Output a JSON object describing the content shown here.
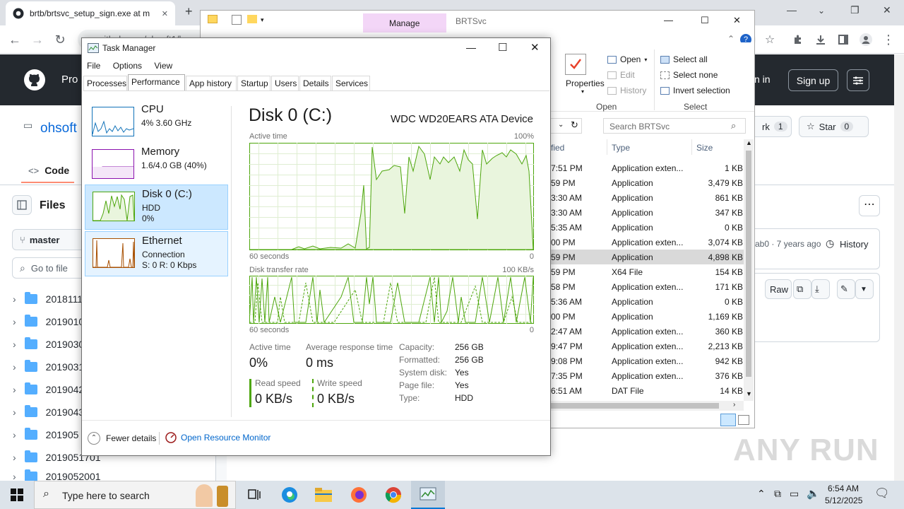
{
  "browser": {
    "tab_title": "brtb/brtsvc_setup_sign.exe at m",
    "tab_close": "✕",
    "new_tab": "+",
    "address": "github.com/ohsoft1/ba",
    "controls": {
      "minimize": "—",
      "maximize": "❐",
      "close": "✕"
    }
  },
  "github": {
    "nav_partial": "Pro",
    "sign_in": "n in",
    "sign_up": "Sign up",
    "owner": "ohsoft",
    "code_tab": "Code",
    "files_label": "Files",
    "branch": "master",
    "go_to_file": "Go to file",
    "fork_label": "rk",
    "fork_count": "1",
    "star_label": "Star",
    "star_count": "0",
    "commit_info": "ab0 · 7 years ago",
    "history": "History",
    "raw": "Raw",
    "folders": [
      "2018111",
      "2019010",
      "2019030",
      "2019031",
      "2019042",
      "2019043",
      "201905",
      "2019051701",
      "2019052001"
    ]
  },
  "explorer": {
    "manage_tab": "Manage",
    "title": "BRTSvc",
    "controls": {
      "minimize": "—",
      "maximize": "☐",
      "close": "✕"
    },
    "ribbon": {
      "properties": "Properties",
      "open": "Open",
      "edit": "Edit",
      "history": "History",
      "group_open": "Open",
      "select_all": "Select all",
      "select_none": "Select none",
      "invert_selection": "Invert selection",
      "group_select": "Select"
    },
    "search_placeholder": "Search BRTSvc",
    "columns": {
      "modified": "fied",
      "type": "Type",
      "size": "Size"
    },
    "rows": [
      {
        "time": "7:51 PM",
        "type": "Application exten...",
        "size": "1 KB"
      },
      {
        "time": "59 PM",
        "type": "Application",
        "size": "3,479 KB"
      },
      {
        "time": "3:30 AM",
        "type": "Application",
        "size": "861 KB"
      },
      {
        "time": "3:30 AM",
        "type": "Application",
        "size": "347 KB"
      },
      {
        "time": "5:35 AM",
        "type": "Application",
        "size": "0 KB"
      },
      {
        "time": "00 PM",
        "type": "Application exten...",
        "size": "3,074 KB"
      },
      {
        "time": "59 PM",
        "type": "Application",
        "size": "4,898 KB",
        "selected": true
      },
      {
        "time": "59 PM",
        "type": "X64 File",
        "size": "154 KB"
      },
      {
        "time": "58 PM",
        "type": "Application exten...",
        "size": "171 KB"
      },
      {
        "time": "5:36 AM",
        "type": "Application",
        "size": "0 KB"
      },
      {
        "time": "00 PM",
        "type": "Application",
        "size": "1,169 KB"
      },
      {
        "time": "2:47 AM",
        "type": "Application exten...",
        "size": "360 KB"
      },
      {
        "time": "9:47 PM",
        "type": "Application exten...",
        "size": "2,213 KB"
      },
      {
        "time": "9:08 PM",
        "type": "Application exten...",
        "size": "942 KB"
      },
      {
        "time": "7:35 PM",
        "type": "Application exten...",
        "size": "376 KB"
      },
      {
        "time": "6:51 AM",
        "type": "DAT File",
        "size": "14 KB"
      }
    ]
  },
  "taskmgr": {
    "title": "Task Manager",
    "controls": {
      "minimize": "—",
      "maximize": "☐",
      "close": "✕"
    },
    "menu": [
      "File",
      "Options",
      "View"
    ],
    "tabs": [
      "Processes",
      "Performance",
      "App history",
      "Startup",
      "Users",
      "Details",
      "Services"
    ],
    "active_tab": "Performance",
    "sidebar": [
      {
        "title": "CPU",
        "sub1": "4% 3.60 GHz",
        "sub2": "",
        "color": "#1172b9"
      },
      {
        "title": "Memory",
        "sub1": "1.6/4.0 GB (40%)",
        "sub2": "",
        "color": "#8b12ae"
      },
      {
        "title": "Disk 0 (C:)",
        "sub1": "HDD",
        "sub2": "0%",
        "color": "#4da60c"
      },
      {
        "title": "Ethernet",
        "sub1": "Connection",
        "sub2": "S: 0 R: 0 Kbps",
        "color": "#a74f01"
      }
    ],
    "disk": {
      "heading": "Disk 0 (C:)",
      "device": "WDC WD20EARS ATA Device",
      "graph1_label": "Active time",
      "graph1_max": "100%",
      "graph2_label": "Disk transfer rate",
      "graph2_max": "100 KB/s",
      "axis_left": "60 seconds",
      "axis_right": "0",
      "active_time_label": "Active time",
      "active_time_value": "0%",
      "avg_response_label": "Average response time",
      "avg_response_value": "0 ms",
      "read_speed_label": "Read speed",
      "read_speed_value": "0 KB/s",
      "write_speed_label": "Write speed",
      "write_speed_value": "0 KB/s",
      "props": [
        {
          "k": "Capacity:",
          "v": "256 GB"
        },
        {
          "k": "Formatted:",
          "v": "256 GB"
        },
        {
          "k": "System disk:",
          "v": "Yes"
        },
        {
          "k": "Page file:",
          "v": "Yes"
        },
        {
          "k": "Type:",
          "v": "HDD"
        }
      ]
    },
    "fewer_details": "Fewer details",
    "open_resource_monitor": "Open Resource Monitor"
  },
  "taskbar": {
    "search_placeholder": "Type here to search",
    "time": "6:54 AM",
    "date": "5/12/2025"
  },
  "watermark": "ANY RUN"
}
